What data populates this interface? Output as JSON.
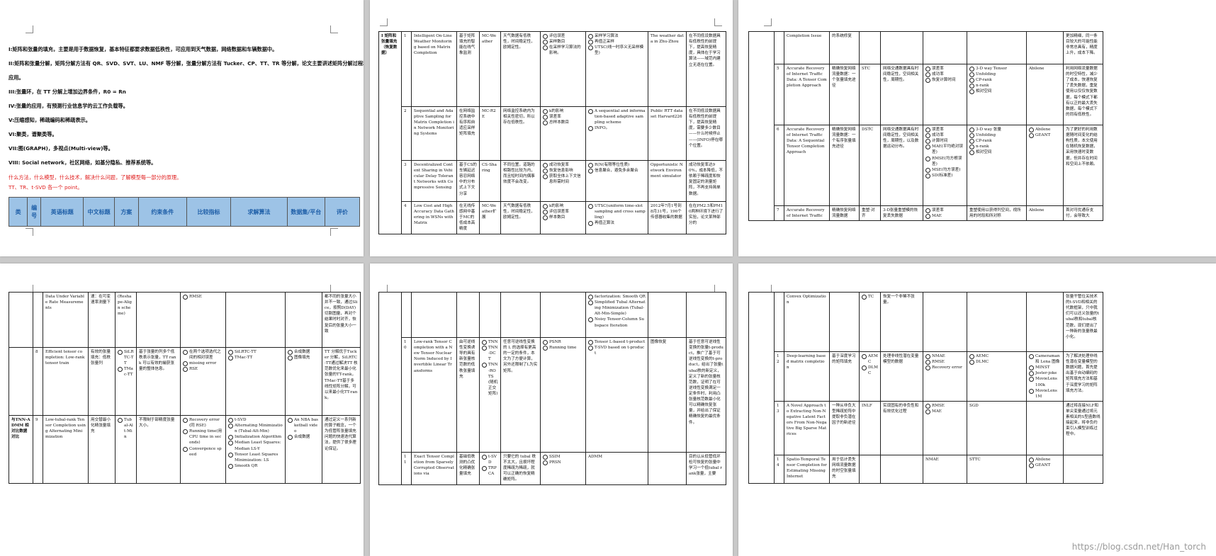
{
  "page1": {
    "lines": [
      "I:矩阵和张量的填充，主要是用于数据恢复，基本特征都要求数据低秩性，可应用到天气数据，网络数据和车辆数据中。",
      "II:矩阵和张量分解，矩阵分解方法有 QR、SVD、SVT、LU、NMF 等分解，张量分解方法有 Tucker、CP、TT、TR 等分解，论文主要讲述矩阵分解过程和",
      "应用。",
      "III:张量环，在 TT 分解上增加边界条件，R0 = Rn",
      "IV:张量的应用，有预测行业信息学的云工作负载等。",
      "V:压缩感知，稀疏编码和稀疏表示。",
      "VI:聚类，谱聚类等。",
      "VII:图(GRAPH)，多视点(Multi-view)等。",
      "VIII: Social network，社区网络，如基分隐私、推荐系统等。"
    ],
    "red_lines": [
      "什么方法，什么模型，什么技术，解决什么问题，了解模型每一部分的原理。",
      "TT、TR、t-SVD 各一个 point。"
    ],
    "headers": [
      "类",
      "编号",
      "英语标题",
      "中文标题",
      "方案",
      "约束条件",
      "比较指标",
      "求解算法",
      "数据集/平台",
      "评价"
    ]
  },
  "page2": {
    "category": "I 矩阵和张量填充（恢复数据）",
    "rows": [
      {
        "num": "1",
        "en": "Intelligent On-Line Weather Monitoring based on Matrix Completion",
        "cn": "基于矩阵填充的智能在线气象监测",
        "scheme": "MC-Weather",
        "constraint": "天气数据有低秩性，时间稳定性，欧姆定性。",
        "metrics": [
          "评估误差",
          "采样数目",
          "在采样学习算法的影响。"
        ],
        "algo": [
          "采样学习算法",
          "再值正采样",
          "UTSC(线一时序义无采样模型)"
        ],
        "dataset": "The weather data in Zhu-Zhou",
        "eval": "在不同低设数据具有低秩性的前提下，提高恢复精度，具体在于学习算法——域范内建立无逐在位置。"
      },
      {
        "num": "2",
        "en": "Sequential and Adaptive Sampling for Matrix Completion in Network Monitoring Systems",
        "cn": "在网络监控系统中有序和自适应采样矩阵填充",
        "scheme": "MC-R2E",
        "constraint": "网络监控系统内为相关性密切，所以存在低秩性。",
        "metrics": [
          "k的影响",
          "误差率",
          "总样本数目"
        ],
        "algo": [
          "A sequential and information-based adaptive sampling scheme",
          "INFO。"
        ],
        "dataset": "Public RTT data set Harvard226",
        "eval": "在不同低设数据具有低秩性的前提下，提高恢复精度，需要多少数目——什么时候停止——(INFO)停在哪个位置。"
      },
      {
        "num": "3",
        "en": "Decentralized Content Sharing in Vehicular Delay Tolerant Networks with Compressive Sensing",
        "cn": "基于CS的车辆延迟容忍网络中的分布式上下文分享",
        "scheme": "CS-Sharing",
        "constraint": "不同位置，道路的相路性比较为内，而且短时间内偶事效度不会改变。",
        "metrics": [
          "成功恢复率",
          "恢复信息影响",
          "获取全体上下文信息所需时间"
        ],
        "algo": [
          "R(N(有限等位性质)",
          "信息聚合，避免多余聚合"
        ],
        "dataset": "Opportunistic Network Environment simulator",
        "eval": "成功恢复率达90%，成本降低，不依赖于稀疏度和恢复固定的测量矩阵，不再支持简单数据。"
      },
      {
        "num": "4",
        "en": "Low Cost and High Accuracy Data Gathering in WSNs with Matrix",
        "cn": "在无线传感网中基于MC的低成本高精度",
        "scheme": "MC-Weather扩展",
        "constraint": "天气数据有低秩性，时间稳定性，欧姆定性。",
        "metrics": [
          "k的影响",
          "评估误差率",
          "样本数目"
        ],
        "algo": [
          "UTSC(uniform time-slot sampling and cross sampling)",
          "再值正算法"
        ],
        "dataset": "2012年7月1号到8月31号，196个传感器收集的数据",
        "eval": "在在PM2.5和PM10两种环境下进行了实验，论文某种部分的"
      }
    ]
  },
  "page3": {
    "rows": [
      {
        "num": "",
        "en": "Completion Issue",
        "cn": "的系统修复",
        "scheme": "",
        "constraint": "",
        "metrics": [],
        "algo": [],
        "dataset": "",
        "eval": "更加精细，同一条目较大的可能性能非常总具有，精度上升，成本下降。"
      },
      {
        "num": "5",
        "en": "Accurate Recovery of Internet Traffic Data: A Tensor Completion Approach",
        "cn": "精确恢复网络流量数据：一个张量填充途径",
        "scheme": "STC",
        "constraint": "网络交通数据具有时间稳定性，空间相关性，周期性。",
        "metrics": [
          "误差率",
          "成功率",
          "恢复计算时间"
        ],
        "algo": [
          "3-D way Tensor",
          "Unfolding",
          "CP-rank",
          "n-rank",
          "相对空间"
        ],
        "dataset": "Abilene",
        "eval": "利用网络流量数据的时空特性，减少了成本，快速恢复了丢失数据，重复使用以仅仅恢复数据，每个模式下都有以正的最大丢失数据，每个模式下的同有低秩性。"
      },
      {
        "num": "6",
        "en": "Accurate Recovery of Internet Traffic Data: A Sequential Tensor Completion Approach",
        "cn": "精确恢复网络流量数据：一个有序张量填充途径",
        "scheme": "DSTC",
        "constraint": "网络交通数据具有时间稳定性，空间相关性，周期性，以及数据运动分布。",
        "metrics": [
          "误差率",
          "成功率",
          "计算时间",
          "MAE(平均绝对误差)",
          "RMSE(均方根误差)",
          "MSE(均方误差)",
          "SD(标准差)"
        ],
        "algo": [
          "3-D way 张量",
          "Unfolding",
          "CP-rank",
          "n-rank",
          "相对空间"
        ],
        "dataset": [
          "Abilene",
          "GEANT"
        ],
        "eval": "为了更好的利用数据随时间变化的结构性质，本文使用在随机恢复数据，采用快速时变数据，但并存在时间和空间上不依赖。"
      },
      {
        "num": "7",
        "en": "Accurate Recovery of Internet Traffic",
        "cn": "精确恢复网络流量数据",
        "scheme": "重塑·对齐",
        "constraint": "3-D张量重塑模的恢复丢失数据",
        "metrics": [
          "误差率",
          "MAE"
        ],
        "algo": "重塑使用以获得列空间，视所用的时段和所对称",
        "dataset": "Abilene",
        "eval": "首对可优通存支付，会导致大"
      }
    ]
  },
  "page4": {
    "rows": [
      {
        "cat": "",
        "num": "",
        "en": "Data Under Variable Rate Measurements",
        "cn": "速：在可变速率测量下",
        "scheme": "(Reshape-Align scheme)",
        "constraint": "",
        "metrics": [
          "RMSE"
        ],
        "algo": [],
        "dataset": "",
        "eval": "都不同的张量大小并不一致，通过Slice，按照D(DAY)切割图量，再对个结果时时对齐，恢复后的张量大小一致"
      },
      {
        "cat": "",
        "num": "8",
        "en": "Efficient tensor completion: Low-rank tensor train",
        "cn": "有效的张量填充：低秩张量列",
        "scheme": [
          "SiLRTC-TT",
          "TMac-TT"
        ],
        "constraint": "基于张量的列多个低秩表示张量，TT rank 可以有效的捕获张量的整体信息。",
        "metrics": [
          "在两个选项选代之间的相对误差",
          "missing error",
          "RSE"
        ],
        "algo": [
          "SiLRTC-TT",
          "TMac-TT"
        ],
        "dataset": [
          "合成数据",
          "图像填充"
        ],
        "eval": "TT 分解优于Tucker 分解，SiLRTC-TT通过解决TT 核范数优化来最小化张量的TT-rank，TMac-TT基于多线性矩阵分解，可以来最小化TT-rank。"
      },
      {
        "cat": "与TNN-ADMM 相对比数据对比",
        "num": "9",
        "en": "Low-tubal-rank Tensor Completion using Alternating Minimization",
        "cn": "用交替最小化精张量填充",
        "scheme": [
          "Tubal-Alt-Min"
        ],
        "constraint": "不限制于部精度张量大小。",
        "metrics": [
          "Recovery error(同 RSE)",
          "Running time(用CPU time in seconds)",
          "Convergence speed"
        ],
        "algo": [
          "t-SVD",
          "Alternating Minimization (Tubal-Alt-Min)",
          "Initialization Algorithm",
          "Median Least Squares: Median LS-Y",
          "Tensor Least Squares Minimization: LS",
          "Smooth QR"
        ],
        "dataset": [
          "An NBA basketball video",
          "合成数据"
        ],
        "eval": "通过定义一系列新的算子概念，一个为低管阵张量填充问题的快速迭代算法，提供了很多理论保证。"
      }
    ]
  },
  "page5": {
    "rows": [
      {
        "num": "",
        "en": "",
        "cn": "",
        "scheme": [],
        "constraint": "",
        "metrics": [],
        "algo": [
          "factorization: Smooth QR",
          "Simplified Tubal Alternating Minimization (Tubal-Alt-Min-Simple)",
          "Noisy Tensor-Column Subspace Iteration"
        ],
        "dataset": "",
        "eval": ""
      },
      {
        "num": "10",
        "en": "Low-rank Tensor Completion with a New Tensor Nuclear Norm Induced by Invertible Linear Transforms",
        "cn": "由可逆线性变换诱导的具有新张量核范数的低秩张量填充",
        "scheme": [
          "TNN",
          "TNN-DCT",
          "TNN-ROTS(随机正交矩阵)"
        ],
        "constraint": "任意可逆线性变换的 L 的选择有更高的一定的条件，本文为了方便计算，另外还限制了L为实矩阵。",
        "metrics": [
          "PSNR",
          "Running time"
        ],
        "algo": [
          "Tensor L-based t-product",
          "T-SVD based on t-product"
        ],
        "dataset": "图像恢复",
        "eval": "基于任意可逆线性变换的张量t-product，推广了基于可逆线性变换的t-product，给出了张量tubal秩的新定义，定义了新的张量核范数，证明了在可逆线性变换满足一定条件时，利用凸张量核范数最小化可以精确恢复张量，并给出了保证精确恢复的最优条件。"
      },
      {
        "num": "11",
        "en": "Exact Tensor Completion from Sparsely Corrupted Observations via",
        "cn": "基础低秩测的凸优化精确张量填充",
        "scheme": [
          "t-SVD",
          "TRPCA"
        ],
        "constraint": "只要它的 tubal 秩不太大，且损坏程度稀疏为稀疏，就可以正确的恢复精确矩阵。",
        "metrics": [
          "SSIM",
          "PRSN"
        ],
        "algo": [
          "ADMM"
        ],
        "dataset": "",
        "eval": "目的以从低管低环检可恢复的张量中学习一个低tubal rank张量，主要"
      }
    ]
  },
  "page6": {
    "rows": [
      {
        "num": "",
        "en": "Convex Optimization",
        "cn": "",
        "scheme": [
          "TC"
        ],
        "constraint": "恢复一个非稀不张量。",
        "metrics": [],
        "algo": "",
        "dataset": [],
        "eval": "张量干管位关技术的t-SVD和相关的代数框架，只中我们可以还义张量的tubal秩和tubal核范数，现们提出了一种新的张量秩最小化。"
      },
      {
        "num": "12",
        "en": "Deep-learning based matrix completion",
        "cn": "基于深度学习的矩阵填充",
        "scheme": [
          "AEMC",
          "DLMC"
        ],
        "constraint": "处理非线性潜在变量模型的数据",
        "metrics": [
          "NMAE",
          "RMSE",
          "Recovery error"
        ],
        "algo": [
          "AEMC",
          "DLMC"
        ],
        "dataset": [
          "Cameraman 和 Lena 图像",
          "MINST",
          "Jester-joke",
          "MovieLens 100k",
          "MovieLens 1M"
        ],
        "eval": "为了解决处理非线性潜在变量模型的数据问题，首先提出基于自动编码的矩阵填充方法和基于深度学习的矩阵填充方法。"
      },
      {
        "num": "13",
        "en": "A Novel Approach to Extracting Non-Negative Latent Factors From Non-Negative Big Sparse Matrices",
        "cn": "一种从非负大型稀疏矩阵中提取非负潜在因子的新途径",
        "scheme": [
          "INLF"
        ],
        "constraint": "实现固有的非负性和有效优化过程",
        "metrics": [
          "RMSE",
          "MAE"
        ],
        "algo": "SGD",
        "dataset": [],
        "eval": "通过将连接NLF和单尖变量通过将元素相关的S型函数线接起来，将非负约束引入模型训练过程中。"
      },
      {
        "num": "14",
        "en": "Spatio-Temporal Tensor Completion for Estimating Missing Internet",
        "cn": "用于估计丢失网络流量数据的时空张量填充",
        "scheme": [],
        "constraint": "",
        "metrics": [
          "NMAE"
        ],
        "algo": "STTC",
        "dataset": [
          "Abilene",
          "GEANT"
        ],
        "eval": ""
      }
    ]
  },
  "watermark": "https://blog.csdn.net/Han_torch"
}
